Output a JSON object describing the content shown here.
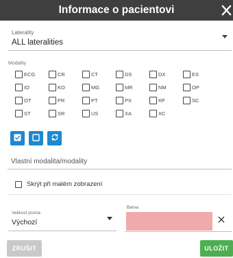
{
  "dialog": {
    "title": "Informace o pacientovi",
    "close_icon": "close-icon"
  },
  "laterality": {
    "label": "Laterality",
    "value": "ALL lateralities"
  },
  "modality": {
    "label": "Modality",
    "items": [
      "ECG",
      "CR",
      "CT",
      "DS",
      "DX",
      "ES",
      "IO",
      "KO",
      "MG",
      "MR",
      "NM",
      "OP",
      "OT",
      "PR",
      "PT",
      "PX",
      "RF",
      "SC",
      "ST",
      "SR",
      "US",
      "XA",
      "XC"
    ],
    "checked": []
  },
  "modality_actions": {
    "icons": [
      "check-all-icon",
      "uncheck-all-icon",
      "invert-icon"
    ],
    "accent": "#1e88d0"
  },
  "custom_modality": {
    "placeholder": "Vlastní modalita/modality"
  },
  "hide_small": {
    "label": "Skrýt při malém zobrazení",
    "checked": false
  },
  "font_size": {
    "label": "Velikost písma",
    "value": "Výchozí"
  },
  "color": {
    "label": "Barva",
    "value": "#f0aaaa"
  },
  "footer": {
    "cancel_label": "ZRUŠIT",
    "save_label": "ULOŽIT",
    "save_color": "#4caf50",
    "cancel_color": "#c9c9c9"
  }
}
